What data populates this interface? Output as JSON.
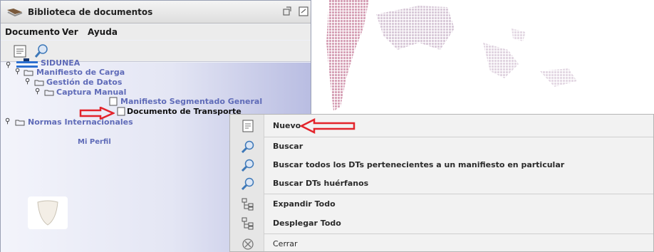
{
  "window": {
    "title": "Biblioteca de documentos"
  },
  "menubar": {
    "items": [
      "Documento",
      "Ver",
      "Ayuda"
    ]
  },
  "toolbar": {
    "icons": [
      "document-icon",
      "search-icon"
    ]
  },
  "tree": {
    "root": "SIDUNEA",
    "manifiesto": "Manifiesto de Carga",
    "gestion": "Gestión de Datos",
    "captura": "Captura Manual",
    "segmentado": "Manifiesto Segmentado General",
    "documento": "Documento de Transporte",
    "normas": "Normas Internacionales",
    "perfil": "Mi Perfil"
  },
  "context_menu": {
    "items": [
      {
        "label": "Nuevo",
        "icon": "new-document-icon"
      },
      {
        "label": "Buscar",
        "icon": "search-icon"
      },
      {
        "label": "Buscar todos los DTs pertenecientes a un manifiesto en particular",
        "icon": "search-icon"
      },
      {
        "label": "Buscar DTs huérfanos",
        "icon": "search-icon"
      },
      {
        "label": "Expandir Todo",
        "icon": "expand-tree-icon"
      },
      {
        "label": "Desplegar Todo",
        "icon": "collapse-tree-icon"
      },
      {
        "label": "Cerrar",
        "icon": "close-icon"
      }
    ]
  },
  "colors": {
    "tree_link": "#5f6bb8",
    "annotation_arrow": "#e3242b",
    "map_dots": "#d7a3b8"
  }
}
